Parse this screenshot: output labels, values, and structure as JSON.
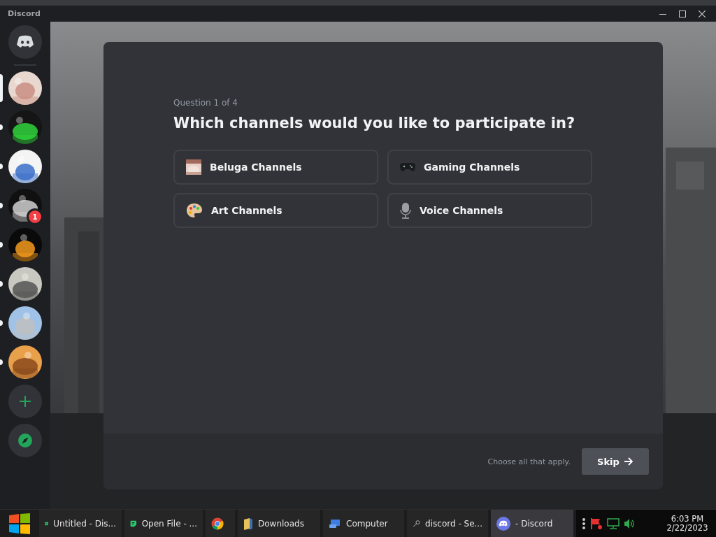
{
  "window": {
    "title": "Discord"
  },
  "servers": [
    {
      "selected": true,
      "unread": false
    },
    {
      "selected": false,
      "unread": true
    },
    {
      "selected": false,
      "unread": true
    },
    {
      "selected": false,
      "unread": true,
      "badge": "1"
    },
    {
      "selected": false,
      "unread": true
    },
    {
      "selected": false,
      "unread": true
    },
    {
      "selected": false,
      "unread": true
    },
    {
      "selected": false,
      "unread": true
    }
  ],
  "question": {
    "counter": "Question 1 of 4",
    "title": "Which channels would you like to participate in?",
    "options": [
      {
        "label": "Beluga Channels",
        "kind": "picture",
        "selected": false
      },
      {
        "label": "Gaming Channels",
        "kind": "controller",
        "selected": false
      },
      {
        "label": "Art Channels",
        "kind": "palette",
        "selected": false
      },
      {
        "label": "Voice Channels",
        "kind": "microphone",
        "selected": false
      }
    ]
  },
  "footer": {
    "hint": "Choose all that apply.",
    "skip": "Skip"
  },
  "taskbar": {
    "items": [
      {
        "label": "Untitled - Dis...",
        "kind": "notes",
        "active": false
      },
      {
        "label": "Open File - ...",
        "kind": "notes",
        "active": false
      },
      {
        "kind": "browser",
        "active": false
      },
      {
        "label": "Downloads",
        "kind": "folder",
        "active": false
      },
      {
        "label": "Computer",
        "kind": "computer",
        "active": false
      },
      {
        "label": "discord - Se...",
        "kind": "search",
        "active": false
      },
      {
        "label": "- Discord",
        "kind": "discord",
        "active": true
      }
    ],
    "time": "6:03 PM",
    "date": "2/22/2023"
  }
}
